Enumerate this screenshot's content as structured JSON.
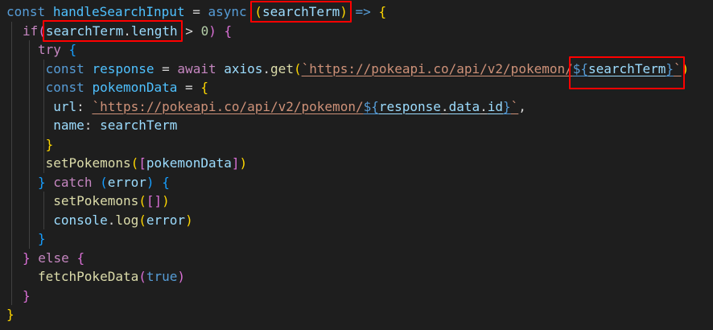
{
  "editor": {
    "lines": [
      {
        "indent": 0,
        "tokens": [
          [
            "kw",
            "const"
          ],
          [
            "op",
            " "
          ],
          [
            "const",
            "handleSearchInput"
          ],
          [
            "op",
            " = "
          ],
          [
            "kw",
            "async"
          ],
          [
            "op",
            " "
          ],
          [
            "p1",
            "("
          ],
          [
            "var",
            "searchTerm"
          ],
          [
            "p1",
            ")"
          ],
          [
            "op",
            " "
          ],
          [
            "kw",
            "=>"
          ],
          [
            "op",
            " "
          ],
          [
            "p1",
            "{"
          ]
        ]
      },
      {
        "indent": 1,
        "tokens": [
          [
            "ctl",
            "if"
          ],
          [
            "p2",
            "("
          ],
          [
            "var",
            "searchTerm"
          ],
          [
            "op",
            "."
          ],
          [
            "var",
            "length"
          ],
          [
            "op",
            " > "
          ],
          [
            "num",
            "0"
          ],
          [
            "p2",
            ")"
          ],
          [
            "op",
            " "
          ],
          [
            "p2",
            "{"
          ]
        ]
      },
      {
        "indent": 2,
        "tokens": [
          [
            "ctl",
            "try"
          ],
          [
            "op",
            " "
          ],
          [
            "p3",
            "{"
          ]
        ]
      },
      {
        "indent": 2,
        "tokens": [
          [
            "op",
            " "
          ],
          [
            "kw",
            "const"
          ],
          [
            "op",
            " "
          ],
          [
            "const",
            "response"
          ],
          [
            "op",
            " = "
          ],
          [
            "ctl",
            "await"
          ],
          [
            "op",
            " "
          ],
          [
            "var",
            "axios"
          ],
          [
            "op",
            "."
          ],
          [
            "fn",
            "get"
          ],
          [
            "p1",
            "("
          ],
          [
            "str",
            "`https://pokeapi.co/api/v2/pokemon/"
          ],
          [
            "kw",
            "${"
          ],
          [
            "var",
            "searchTerm"
          ],
          [
            "kw",
            "}"
          ],
          [
            "str",
            "`"
          ],
          [
            "p1",
            ")"
          ]
        ]
      },
      {
        "indent": 2,
        "tokens": [
          [
            "op",
            " "
          ],
          [
            "kw",
            "const"
          ],
          [
            "op",
            " "
          ],
          [
            "const",
            "pokemonData"
          ],
          [
            "op",
            " = "
          ],
          [
            "p1",
            "{"
          ]
        ]
      },
      {
        "indent": 2,
        "tokens": [
          [
            "op",
            "  "
          ],
          [
            "var",
            "url"
          ],
          [
            "op",
            ": "
          ],
          [
            "str",
            "`https://pokeapi.co/api/v2/pokemon/"
          ],
          [
            "kw",
            "${"
          ],
          [
            "var",
            "response"
          ],
          [
            "op",
            "."
          ],
          [
            "var",
            "data"
          ],
          [
            "op",
            "."
          ],
          [
            "var",
            "id"
          ],
          [
            "kw",
            "}"
          ],
          [
            "str",
            "`"
          ],
          [
            "op",
            ","
          ]
        ]
      },
      {
        "indent": 2,
        "tokens": [
          [
            "op",
            "  "
          ],
          [
            "var",
            "name"
          ],
          [
            "op",
            ": "
          ],
          [
            "var",
            "searchTerm"
          ]
        ]
      },
      {
        "indent": 2,
        "tokens": [
          [
            "op",
            " "
          ],
          [
            "p1",
            "}"
          ]
        ]
      },
      {
        "indent": 2,
        "tokens": [
          [
            "op",
            " "
          ],
          [
            "fn",
            "setPokemons"
          ],
          [
            "p1",
            "("
          ],
          [
            "p2",
            "["
          ],
          [
            "var",
            "pokemonData"
          ],
          [
            "p2",
            "]"
          ],
          [
            "p1",
            ")"
          ]
        ]
      },
      {
        "indent": 2,
        "tokens": [
          [
            "p3",
            "}"
          ],
          [
            "op",
            " "
          ],
          [
            "ctl",
            "catch"
          ],
          [
            "op",
            " "
          ],
          [
            "p3",
            "("
          ],
          [
            "var",
            "error"
          ],
          [
            "p3",
            ")"
          ],
          [
            "op",
            " "
          ],
          [
            "p3",
            "{"
          ]
        ]
      },
      {
        "indent": 2,
        "tokens": [
          [
            "op",
            "  "
          ],
          [
            "fn",
            "setPokemons"
          ],
          [
            "p1",
            "("
          ],
          [
            "p2",
            "[]"
          ],
          [
            "p1",
            ")"
          ]
        ]
      },
      {
        "indent": 2,
        "tokens": [
          [
            "op",
            "  "
          ],
          [
            "var",
            "console"
          ],
          [
            "op",
            "."
          ],
          [
            "fn",
            "log"
          ],
          [
            "p1",
            "("
          ],
          [
            "var",
            "error"
          ],
          [
            "p1",
            ")"
          ]
        ]
      },
      {
        "indent": 2,
        "tokens": [
          [
            "p3",
            "}"
          ]
        ]
      },
      {
        "indent": 1,
        "tokens": [
          [
            "p2",
            "}"
          ],
          [
            "op",
            " "
          ],
          [
            "ctl",
            "else"
          ],
          [
            "op",
            " "
          ],
          [
            "p2",
            "{"
          ]
        ]
      },
      {
        "indent": 2,
        "tokens": [
          [
            "fn",
            "fetchPokeData"
          ],
          [
            "p2",
            "("
          ],
          [
            "kw",
            "true"
          ],
          [
            "p2",
            ")"
          ]
        ]
      },
      {
        "indent": 1,
        "tokens": [
          [
            "p2",
            "}"
          ]
        ]
      },
      {
        "indent": 0,
        "tokens": [
          [
            "p1",
            "}"
          ]
        ]
      }
    ],
    "highlights": [
      "(searchTerm)",
      "searchTerm.length",
      "${searchTerm}"
    ]
  }
}
